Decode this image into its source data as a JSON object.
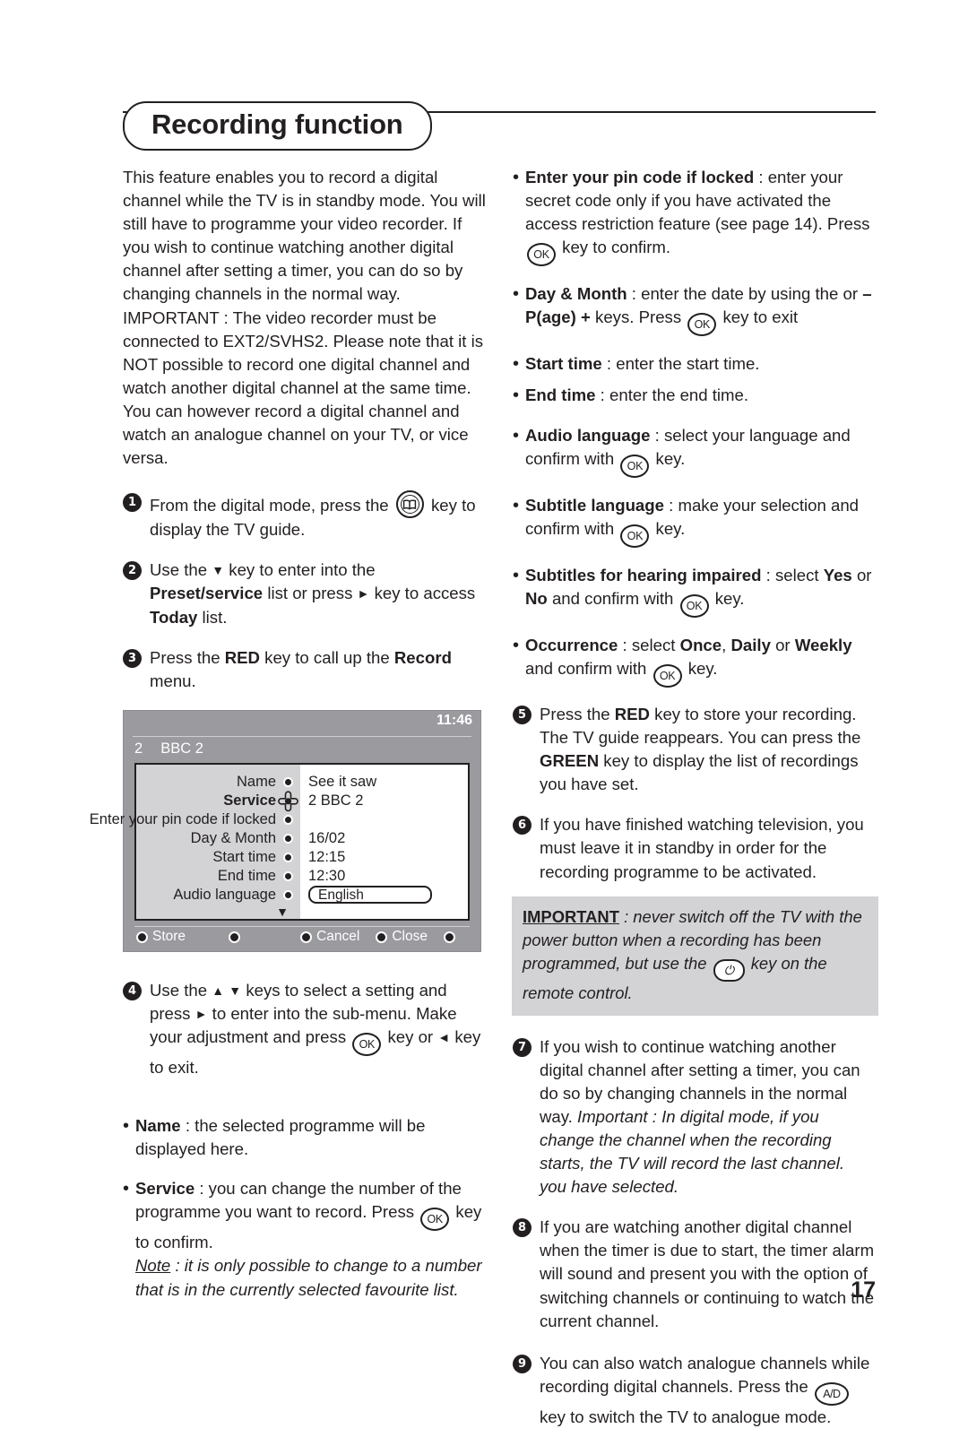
{
  "header": {
    "title": "Recording function"
  },
  "left_column": {
    "intro": "This feature enables you to record a digital channel while the TV is in standby mode. You will still have to programme your video recorder. If you wish to continue watching another digital channel after setting a timer, you can do so by changing channels in the normal way. IMPORTANT : The video recorder must be connected to EXT2/SVHS2. Please note that it is NOT possible to record one digital channel and watch another digital channel at the same time. You can however record a digital channel and watch an analogue channel on your TV, or vice versa.",
    "step1": {
      "num": "1",
      "part_a": "From the digital mode, press the",
      "part_b": "key to display the TV guide."
    },
    "step2": {
      "num": "2",
      "part_a": "Use the",
      "arrow_down": "▼",
      "part_b": "key to enter into the",
      "bold_1": "Preset/service",
      "part_c": "list or press",
      "arrow_right": "►",
      "part_d": "key to access",
      "bold_2": "Today",
      "part_e": "list."
    },
    "step3": {
      "num": "3",
      "part_a": "Press the",
      "bold_1": "RED",
      "part_b": "key to call up the",
      "bold_2": "Record",
      "part_c": "menu."
    },
    "step4": {
      "num": "4",
      "part_a": "Use the",
      "arrow_up": "▲",
      "arrow_down": "▼",
      "part_b": "keys to select a setting and press",
      "arrow_right": "►",
      "part_c": "to enter into the sub-menu. Make your adjustment and press",
      "key_ok": "OK",
      "part_d": "key or",
      "arrow_left": "◄",
      "part_e": "key to exit."
    },
    "bullets": [
      {
        "label": "Name",
        "sep": " : ",
        "text": "the selected programme will be displayed here."
      },
      {
        "label": "Service",
        "sep": " : ",
        "text": "you can change the number of the programme you want to record. Press",
        "key_ok": "OK",
        "text2": "key to confirm.",
        "note_label": "Note",
        "note_text": " : it is only possible to change to a number that is in the currently selected favourite list."
      }
    ]
  },
  "tv_screen": {
    "clock": "11:46",
    "channel_number": "2",
    "channel_name": "BBC 2",
    "rows": [
      {
        "label": "Name",
        "value": "See it saw",
        "selected": false,
        "type": "text"
      },
      {
        "label": "Service",
        "value": "2 BBC 2",
        "selected": true,
        "type": "text"
      },
      {
        "label": "Enter your pin code if locked",
        "value": "",
        "selected": false,
        "type": "text"
      },
      {
        "label": "Day & Month",
        "value": "16/02",
        "selected": false,
        "type": "text"
      },
      {
        "label": "Start time",
        "value": "12:15",
        "selected": false,
        "type": "text"
      },
      {
        "label": "End time",
        "value": "12:30",
        "selected": false,
        "type": "text"
      },
      {
        "label": "Audio language",
        "value": "English",
        "selected": false,
        "type": "box"
      }
    ],
    "scroll_caret": "▼",
    "footer_keys": [
      {
        "label": "Store"
      },
      {
        "label": ""
      },
      {
        "label": "Cancel"
      },
      {
        "label": "Close"
      },
      {
        "label": ""
      }
    ],
    "colors": {
      "chrome": "#9a9a9f",
      "panel_left": "#d3d3d5",
      "panel_right": "#ffffff",
      "text_on_chrome": "#ffffff"
    }
  },
  "right_column": {
    "bullets": [
      {
        "label": "Enter your pin code if locked",
        "sep": " : ",
        "text": "enter your secret code only if you have activated the access restriction feature (see page 14). Press",
        "key_ok": "OK",
        "text2": "key to confirm."
      },
      {
        "label": "Day & Month",
        "sep": " : ",
        "text": "enter the date by using the or",
        "bold_mid": "– P(age) +",
        "text2": "keys. Press",
        "key_ok": "OK",
        "text3": "key to exit"
      },
      {
        "label": "Start time",
        "sep": " : ",
        "text": "enter the start time."
      },
      {
        "label": "End time",
        "sep": " : ",
        "text": "enter the end time."
      },
      {
        "label": "Audio language",
        "sep": " : ",
        "text": "select your language and confirm with",
        "key_ok": "OK",
        "text2": "key."
      },
      {
        "label": "Subtitle language",
        "sep": " : ",
        "text": "make your selection and confirm with",
        "key_ok": "OK",
        "text2": "key."
      },
      {
        "label": "Subtitles for hearing impaired",
        "sep": " : ",
        "text": "select",
        "bold_1": "Yes",
        "text2": "or",
        "bold_2": "No",
        "text3": "and confirm with",
        "key_ok": "OK",
        "text4": "key."
      },
      {
        "label": "Occurrence",
        "sep": " : ",
        "text": "select",
        "bold_1": "Once",
        "comma": ",",
        "bold_2": "Daily",
        "text2": "or",
        "bold_3": "Weekly",
        "text3": "and confirm with",
        "key_ok": "OK",
        "text4": "key."
      }
    ],
    "step5": {
      "num": "5",
      "part_a": "Press the",
      "bold_1": "RED",
      "part_b": "key to store your recording. The TV guide reappears. You can press the",
      "bold_2": "GREEN",
      "part_c": "key to display the list of recordings you have set."
    },
    "step6": {
      "num": "6",
      "text": "If you have finished watching television, you must leave it in standby in order for the recording programme to be activated."
    },
    "important": {
      "label": "IMPORTANT",
      "part_a": " : never switch off the TV with the power button when a recording has been programmed, but use the",
      "part_b": "key on the remote control."
    },
    "step7": {
      "num": "7",
      "part_a": "If you wish to continue watching another digital channel after setting a timer, you can do so by changing channels in the normal way.",
      "italic": "Important : In digital mode, if you change the channel when the recording starts, the TV will record the last channel. you have selected."
    },
    "step8": {
      "num": "8",
      "text": "If you are watching another digital channel when the timer is due to start, the timer alarm will sound and present you with the option of switching channels or continuing to watch the current channel."
    },
    "step9": {
      "num": "9",
      "part_a": "You can also watch analogue channels while recording digital channels. Press the",
      "key_ad": "A/D",
      "part_b": "key to switch the TV to analogue mode."
    }
  },
  "footer": {
    "page_number": "17"
  }
}
